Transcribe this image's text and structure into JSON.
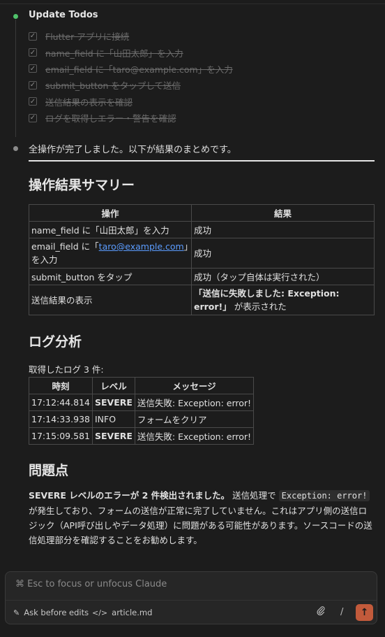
{
  "todos": {
    "title": "Update Todos",
    "items": [
      "Flutter アプリに接続",
      "name_field に「山田太郎」を入力",
      "email_field に「taro@example.com」を入力",
      "submit_button をタップして送信",
      "送信結果の表示を確認",
      "ログを取得しエラー・警告を確認"
    ]
  },
  "status_text": "全操作が完了しました。以下が結果のまとめです。",
  "summary": {
    "heading": "操作結果サマリー",
    "headers": [
      "操作",
      "結果"
    ],
    "rows": [
      {
        "op": "name_field に「山田太郎」を入力",
        "result": "成功"
      },
      {
        "op_prefix": "email_field に「",
        "op_link": "taro@example.com",
        "op_suffix": "」を入力",
        "result": "成功"
      },
      {
        "op": "submit_button をタップ",
        "result": "成功（タップ自体は実行された）"
      },
      {
        "op": "送信結果の表示",
        "result_bold": "「送信に失敗しました: Exception: error!」",
        "result_suffix": " が表示された"
      }
    ]
  },
  "log": {
    "heading": "ログ分析",
    "intro": "取得したログ 3 件:",
    "headers": [
      "時刻",
      "レベル",
      "メッセージ"
    ],
    "rows": [
      {
        "time": "17:12:44.814",
        "level": "SEVERE",
        "message": "送信失敗: Exception: error!"
      },
      {
        "time": "17:14:33.938",
        "level": "INFO",
        "message": "フォームをクリア"
      },
      {
        "time": "17:15:09.581",
        "level": "SEVERE",
        "message": "送信失敗: Exception: error!"
      }
    ]
  },
  "issues": {
    "heading": "問題点",
    "bold_lead": "SEVERE レベルのエラーが 2 件検出されました。",
    "text_before_code": " 送信処理で ",
    "code": "Exception: error!",
    "text_after_code": " が発生しており、フォームの送信が正常に完了していません。これはアプリ側の送信ロジック（API呼び出しやデータ処理）に問題がある可能性があります。ソースコードの送信処理部分を確認することをお勧めします。"
  },
  "composer": {
    "placeholder": "⌘ Esc to focus or unfocus Claude",
    "ask_label": "Ask before edits",
    "file_label": "article.md",
    "slash": "/"
  },
  "icons": {
    "todo_dot": "status-dot-icon",
    "check": "checkbox-checked-icon",
    "pencil": "pencil-icon",
    "code": "code-icon",
    "paperclip": "paperclip-icon",
    "send": "arrow-up-icon"
  },
  "colors": {
    "background": "#1c1c1c",
    "accent_green": "#4fc26a",
    "link": "#5b9cff",
    "send_button": "#c25a3b"
  }
}
